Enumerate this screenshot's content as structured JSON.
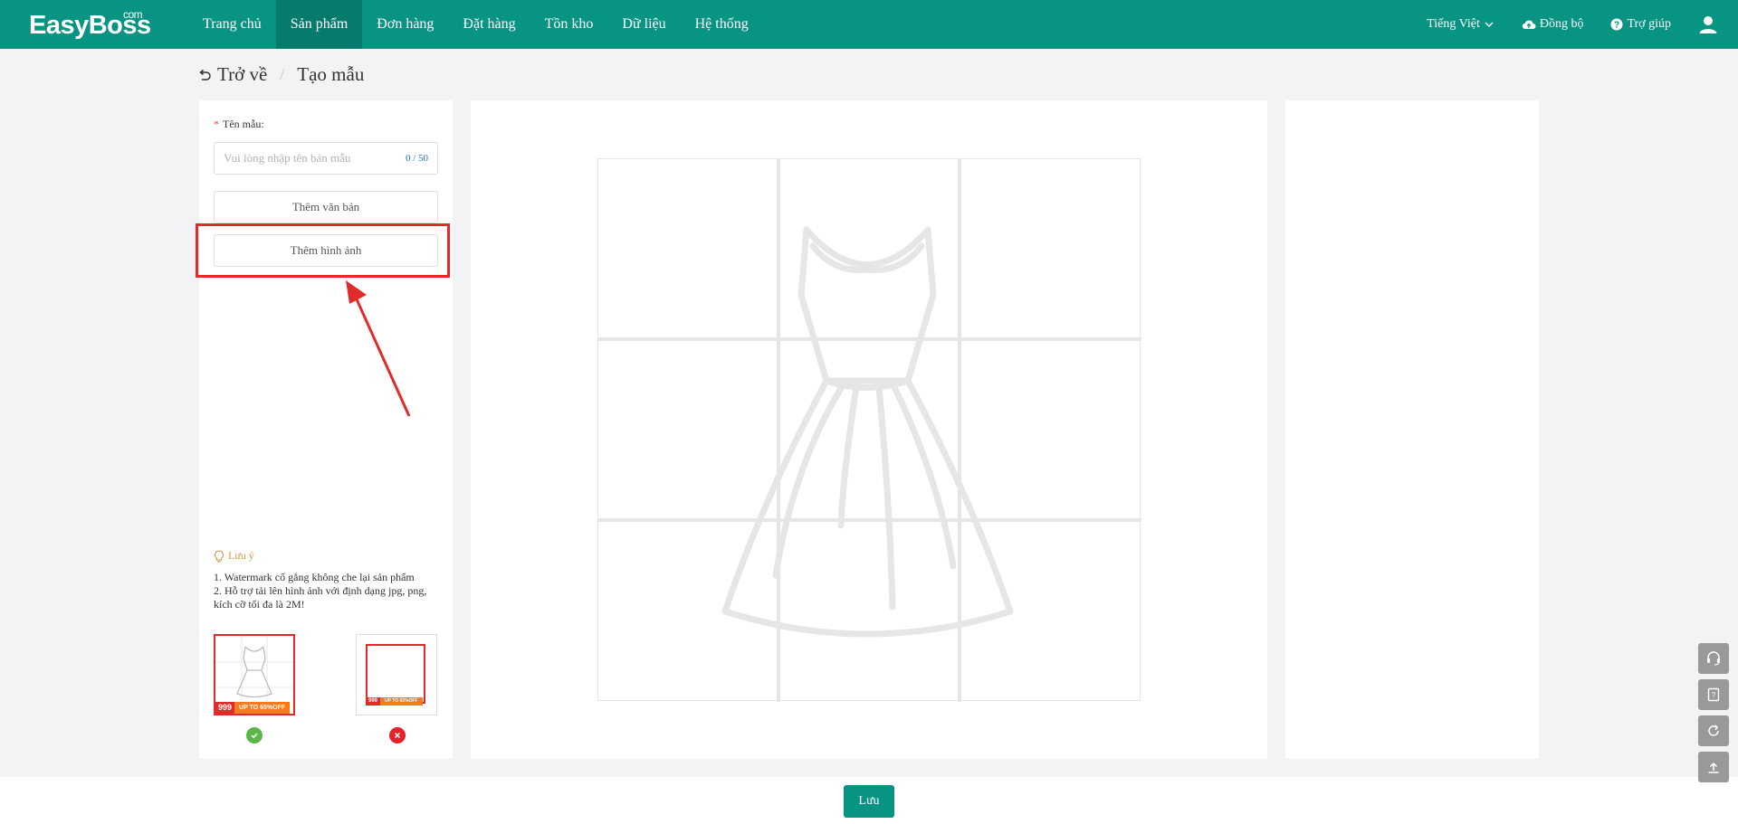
{
  "app": {
    "logo": "EasyBoss",
    "logo_suffix": "com"
  },
  "nav": {
    "items": [
      {
        "label": "Trang chủ"
      },
      {
        "label": "Sản phẩm"
      },
      {
        "label": "Đơn hàng"
      },
      {
        "label": "Đặt hàng"
      },
      {
        "label": "Tồn kho"
      },
      {
        "label": "Dữ liệu"
      },
      {
        "label": "Hệ thống"
      }
    ],
    "active_index": 1
  },
  "header_right": {
    "language": "Tiếng Việt",
    "sync": "Đồng bộ",
    "help": "Trợ giúp",
    "icons": {
      "language": "chevron-down-icon",
      "sync": "cloud-icon",
      "help": "question-icon",
      "user": "user-icon"
    }
  },
  "breadcrumb": {
    "back": "Trở về",
    "current": "Tạo mẫu"
  },
  "form": {
    "name_label": "Tên mẫu:",
    "required_mark": "*",
    "name_placeholder": "Vui lòng nhập tên bản mẫu",
    "name_value": "",
    "name_count": "0 / 50",
    "add_text_label": "Thêm văn bản",
    "add_image_label": "Thêm hình ảnh"
  },
  "notes": {
    "title": "Lưu ý",
    "line1": "1. Watermark cố gắng không che lại sản phẩm",
    "line2": "2. Hỗ trợ tải lên hình ảnh với định dạng jpg, png, kích cỡ tối đa là 2M!"
  },
  "examples": {
    "good": {
      "price": "999",
      "badge": "UP TO 65%OFF"
    },
    "bad": {
      "price": "999",
      "badge": "UP TO 65%OFF"
    }
  },
  "footer": {
    "save_label": "Lưu"
  },
  "colors": {
    "brand": "#079482",
    "highlight": "#e02b2b",
    "ok": "#5bb749",
    "error": "#e0242a"
  }
}
